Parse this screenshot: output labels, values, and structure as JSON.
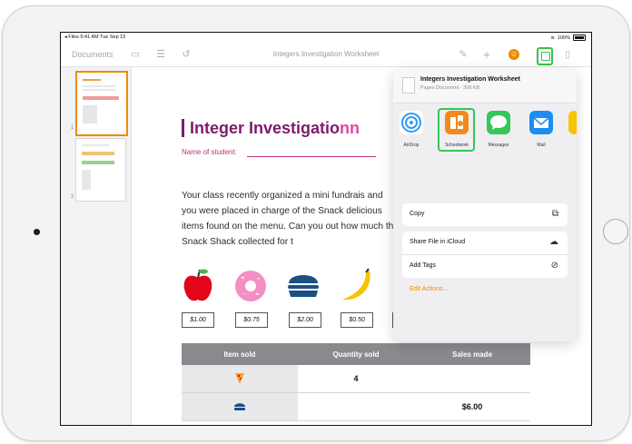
{
  "status_bar": {
    "left": "◂ Files  9:41 AM  Tue Sep 15",
    "battery": "100%"
  },
  "toolbar": {
    "documents_label": "Documents",
    "title": "Integers Investigation Worksheet",
    "collaborator_initial": ""
  },
  "thumbnails": [
    {
      "number": "1"
    },
    {
      "number": "2"
    }
  ],
  "document": {
    "title_part1": "Integer Investigatio",
    "title_part2": "nn",
    "student_label": "Name of student:",
    "paragraph": "Your class recently organized a mini fundrais and you were placed in charge of the Snack delicious items found on the menu. Can you out how much the Snack Shack collected for t",
    "prices": [
      "$1.00",
      "$0.75",
      "$2.00",
      "$0.50"
    ],
    "table": {
      "headers": [
        "Item sold",
        "Quantity sold",
        "Sales made"
      ],
      "rows": [
        {
          "quantity": "4",
          "sales": ""
        },
        {
          "quantity": "",
          "sales": "$6.00"
        }
      ]
    }
  },
  "share_sheet": {
    "doc_title": "Integers Investigation Worksheet",
    "doc_subtitle": "Pages Document · 308 KB",
    "apps": [
      {
        "label": "AirDrop",
        "color": "#2f9bf4"
      },
      {
        "label": "Schoolwork",
        "color": "#f08a1c"
      },
      {
        "label": "Messages",
        "color": "#34c759"
      },
      {
        "label": "Mail",
        "color": "#1d8df2"
      }
    ],
    "actions_group1": [
      {
        "label": "Copy"
      }
    ],
    "actions_group2": [
      {
        "label": "Share File in iCloud"
      },
      {
        "label": "Add Tags"
      }
    ],
    "edit_actions_label": "Edit Actions..."
  },
  "colors": {
    "accent": "#f08a00",
    "title_purple": "#7b1c6d",
    "pink": "#e0499a"
  }
}
